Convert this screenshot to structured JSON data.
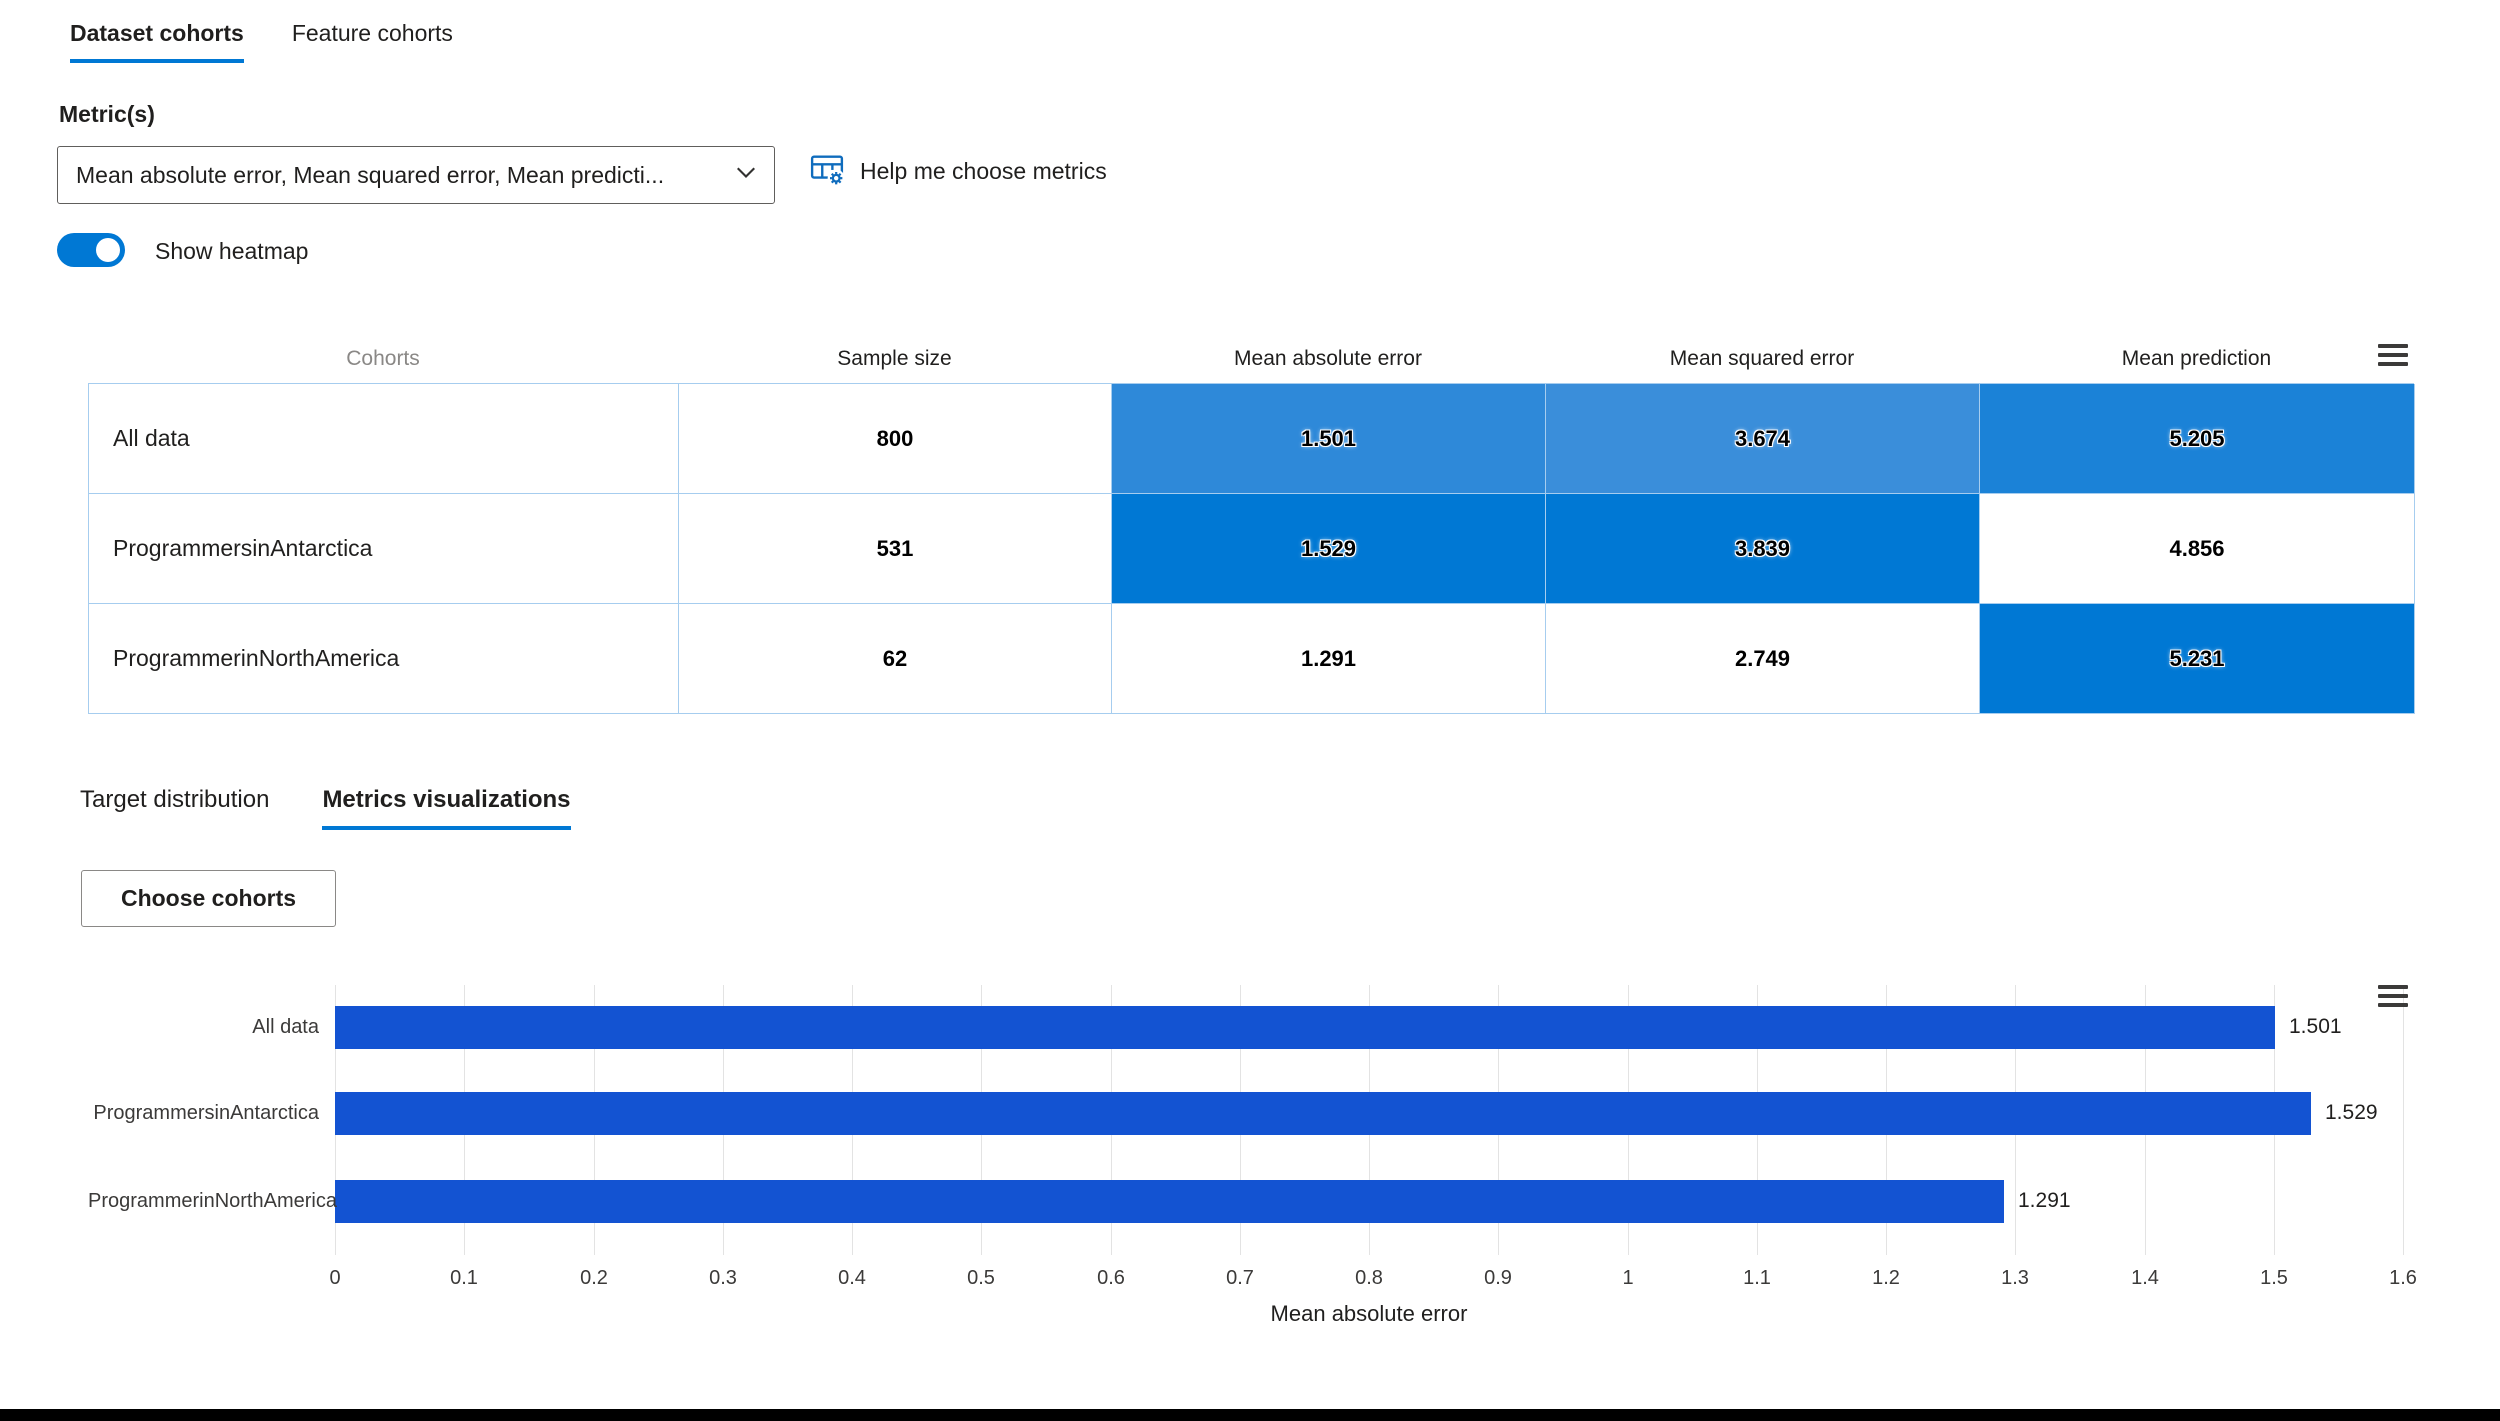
{
  "tabs": {
    "dataset_label": "Dataset cohorts",
    "feature_label": "Feature cohorts"
  },
  "metric_section": {
    "label": "Metric(s)",
    "dropdown_value": "Mean absolute error, Mean squared error, Mean predicti...",
    "help_label": "Help me choose metrics",
    "heatmap_toggle_label": "Show heatmap",
    "heatmap_on": true
  },
  "table": {
    "headers": [
      "Cohorts",
      "Sample size",
      "Mean absolute error",
      "Mean squared error",
      "Mean prediction"
    ],
    "rows": [
      {
        "cohort": "All data",
        "sample_size": "800",
        "cells": [
          {
            "value": "1.501",
            "bg": "#2e89d9"
          },
          {
            "value": "3.674",
            "bg": "#3a8eda"
          },
          {
            "value": "5.205",
            "bg": "#1b82d7"
          }
        ]
      },
      {
        "cohort": "ProgrammersinAntarctica",
        "sample_size": "531",
        "cells": [
          {
            "value": "1.529",
            "bg": "#0078d4"
          },
          {
            "value": "3.839",
            "bg": "#0078d4"
          },
          {
            "value": "4.856",
            "bg": "#ffffff"
          }
        ]
      },
      {
        "cohort": "ProgrammerinNorthAmerica",
        "sample_size": "62",
        "cells": [
          {
            "value": "1.291",
            "bg": "#ffffff"
          },
          {
            "value": "2.749",
            "bg": "#ffffff"
          },
          {
            "value": "5.231",
            "bg": "#0078d4"
          }
        ]
      }
    ]
  },
  "viz_tabs": {
    "target_label": "Target distribution",
    "metrics_label": "Metrics visualizations"
  },
  "choose_cohorts_button": "Choose cohorts",
  "chart_data": {
    "type": "bar",
    "orientation": "horizontal",
    "categories": [
      "All data",
      "ProgrammersinAntarctica",
      "ProgrammerinNorthAmerica"
    ],
    "values": [
      1.501,
      1.529,
      1.291
    ],
    "bar_labels": [
      "1.501",
      "1.529",
      "1.291"
    ],
    "title": "",
    "xlabel": "Mean absolute error",
    "ylabel": "",
    "xlim": [
      0,
      1.6
    ],
    "xtick_labels": [
      "0",
      "0.1",
      "0.2",
      "0.3",
      "0.4",
      "0.5",
      "0.6",
      "0.7",
      "0.8",
      "0.9",
      "1",
      "1.1",
      "1.2",
      "1.3",
      "1.4",
      "1.5",
      "1.6"
    ],
    "grid": true,
    "legend": false,
    "bar_color": "#1353d2"
  },
  "icons": {
    "dropdown": "chevron-down-icon",
    "help": "table-settings-icon",
    "table_menu": "hamburger-menu-icon",
    "chart_menu": "hamburger-menu-icon"
  },
  "colors": {
    "accent": "#0078d4",
    "heatmap_high": "#0078d4",
    "heatmap_mid": "#2e89d9",
    "bar": "#1353d2",
    "grid_line": "#e3e3e3",
    "table_border": "#a6cdef",
    "footer": "#000000"
  }
}
